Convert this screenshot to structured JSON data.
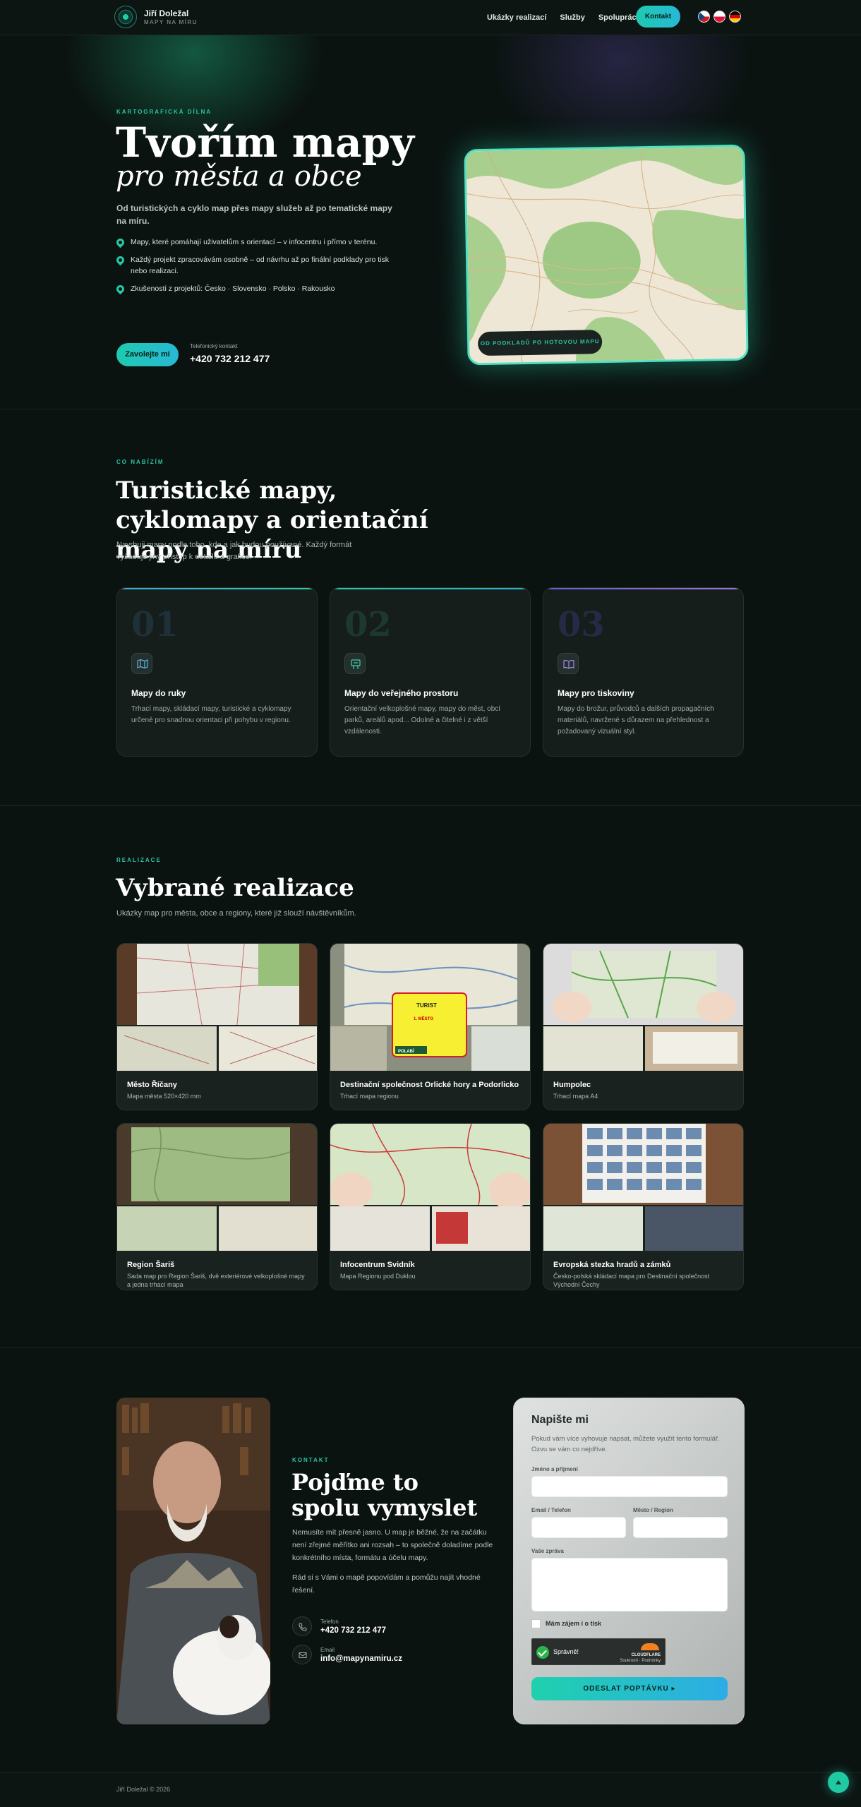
{
  "header": {
    "brand_name": "Jiří Doležal",
    "brand_tagline": "MAPY NA MÍRU",
    "nav": [
      "Ukázky realizací",
      "Služby",
      "Spolupráce"
    ],
    "contact_button": "Kontakt",
    "languages": [
      "Čeština",
      "Polski",
      "Deutsch"
    ]
  },
  "hero": {
    "eyebrow": "KARTOGRAFICKÁ DÍLNA",
    "title": "Tvořím mapy",
    "subtitle": "pro města a obce",
    "lead": "Od turistických a cyklo map přes mapy služeb až po tematické mapy na míru.",
    "bullets": [
      "Mapy, které pomáhají uživatelům s orientací – v infocentru i přímo v terénu.",
      "Každý projekt zpracovávám osobně – od návrhu až po finální podklady pro tisk nebo realizaci.",
      "Zkušenosti z projektů: Česko · Slovensko · Polsko · Rakousko"
    ],
    "cta": "Zavolejte mi",
    "phone_label": "Telefonický kontakt",
    "phone": "+420 732 212 477",
    "map_badge": "OD PODKLADŮ PO HOTOVOU MAPU"
  },
  "services": {
    "eyebrow": "CO NABÍZÍM",
    "title": "Turistické mapy, cyklomapy a orientační mapy na míru",
    "lead": "Navrhuji mapy podle toho, kde a jak budou používané. Každý formát vyžaduje jiný přístup k detailu a grafice.",
    "cards": [
      {
        "num": "01",
        "icon": "map-icon",
        "title": "Mapy do ruky",
        "desc": "Trhací mapy, skládací mapy, turistické a cyklomapy určené pro snadnou orientaci při pohybu v regionu.",
        "accent": "#3fa6d8"
      },
      {
        "num": "02",
        "icon": "signboard-icon",
        "title": "Mapy do veřejného prostoru",
        "desc": "Orientační velkoplošné mapy, mapy do měst, obcí parků, areálů apod... Odolné a čitelné i z větší vzdálenosti.",
        "accent": "#28c7a2"
      },
      {
        "num": "03",
        "icon": "book-icon",
        "title": "Mapy pro tiskoviny",
        "desc": "Mapy do brožur, průvodců a dalších propagačních materiálů, navržené s důrazem na přehlednost a požadovaný vizuální styl.",
        "accent": "#8a6ad8"
      }
    ]
  },
  "portfolio": {
    "eyebrow": "REALIZACE",
    "title": "Vybrané realizace",
    "lead": "Ukázky map pro města, obce a regiony, které již slouží návštěvníkům.",
    "items": [
      {
        "title": "Město Říčany",
        "desc": "Mapa města 520×420 mm"
      },
      {
        "title": "Destinační společnost Orlické hory a Podorlicko",
        "desc": "Trhací mapa regionu"
      },
      {
        "title": "Humpolec",
        "desc": "Trhací mapa A4"
      },
      {
        "title": "Region Šariš",
        "desc": "Sada map pro Region Šariš, dvě exteriérové velkoplošné mapy a jedna trhací mapa"
      },
      {
        "title": "Infocentrum Svidník",
        "desc": "Mapa Regionu pod Duklou"
      },
      {
        "title": "Evropská stezka hradů a zámků",
        "desc": "Česko-polská skládací mapa pro Destinační společnost Východní Čechy"
      }
    ],
    "sign_text": {
      "top": "TURIST",
      "line": "1. MĚSTO",
      "brand": "POLABÍ"
    }
  },
  "contact": {
    "eyebrow": "KONTAKT",
    "title": "Pojďme to spolu vymyslet",
    "p1": "Nemusíte mít přesně jasno. U map je běžné, že na začátku není zřejmé měřítko ani rozsah – to společně doladíme podle konkrétního místa, formátu a účelu mapy.",
    "p2": "Rád si s Vámi o mapě popovídám a pomůžu najít vhodné řešení.",
    "phone_label": "Telefon",
    "phone": "+420 732 212 477",
    "email_label": "Email",
    "email": "info@mapynamiru.cz"
  },
  "form": {
    "title": "Napište mi",
    "note": "Pokud vám více vyhovuje napsat, můžete využít tento formulář. Ozvu se vám co nejdříve.",
    "name_label": "Jméno a příjmení",
    "email_label": "Email / Telefon",
    "city_label": "Město / Region",
    "message_label": "Vaše zpráva",
    "checkbox_label": "Mám zájem i o tisk",
    "captcha_text": "Správně!",
    "captcha_brand": "CLOUDFLARE",
    "captcha_links": "Soukromí · Podmínky",
    "submit": "ODESLAT POPTÁVKU ▸"
  },
  "footer": {
    "copyright": "Jiří Doležal © 2026"
  },
  "colors": {
    "accent": "#28c7a2",
    "background": "#0b1311"
  }
}
